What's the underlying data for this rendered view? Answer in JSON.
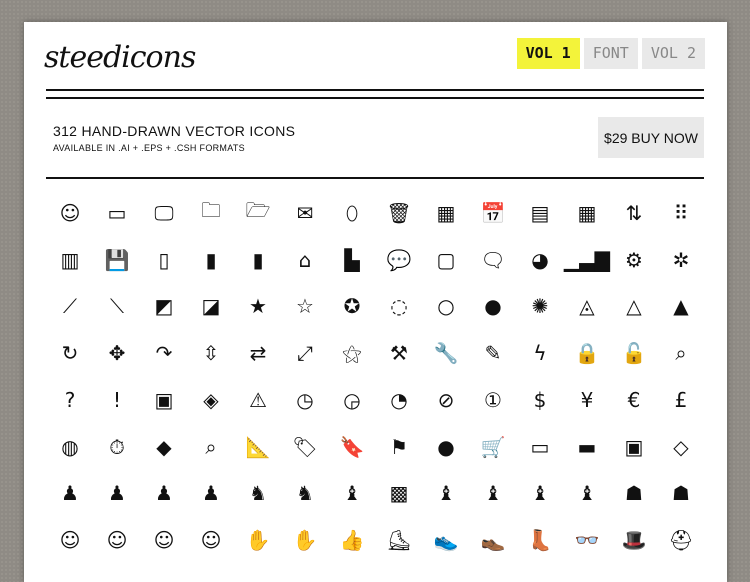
{
  "header": {
    "logo": "steedicons",
    "tabs": [
      {
        "label": "VOL 1",
        "active": true
      },
      {
        "label": "FONT",
        "active": false
      },
      {
        "label": "VOL 2",
        "active": false
      }
    ]
  },
  "intro": {
    "title": "312 HAND-DRAWN VECTOR ICONS",
    "formats": "AVAILABLE IN .AI + .EPS + .CSH FORMATS",
    "buy_label": "$29 BUY NOW"
  },
  "colors": {
    "accent": "#f3f33a",
    "tab_bg": "#e9e9e9",
    "ink": "#111111",
    "backdrop": "#8f8b85"
  },
  "icons": [
    [
      {
        "name": "finder-icon",
        "glyph": "☺"
      },
      {
        "name": "window-icon",
        "glyph": "▭"
      },
      {
        "name": "monitor-icon",
        "glyph": "🖵"
      },
      {
        "name": "folder-icon",
        "glyph": "🗀"
      },
      {
        "name": "open-folder-icon",
        "glyph": "🗁"
      },
      {
        "name": "mail-icon",
        "glyph": "✉"
      },
      {
        "name": "mouse-icon",
        "glyph": "⬯"
      },
      {
        "name": "trash-icon",
        "glyph": "🗑"
      },
      {
        "name": "calculator-icon",
        "glyph": "▦"
      },
      {
        "name": "calendar-11-icon",
        "glyph": "📅"
      },
      {
        "name": "calendar-icon",
        "glyph": "▤"
      },
      {
        "name": "table-icon",
        "glyph": "▦"
      },
      {
        "name": "sort-icon",
        "glyph": "⇅"
      },
      {
        "name": "grid-dots-icon",
        "glyph": "⠿"
      }
    ],
    [
      {
        "name": "ledger-icon",
        "glyph": "▥"
      },
      {
        "name": "floppy-disk-icon",
        "glyph": "💾"
      },
      {
        "name": "battery-low-icon",
        "glyph": "▯"
      },
      {
        "name": "battery-half-icon",
        "glyph": "▮"
      },
      {
        "name": "battery-full-icon",
        "glyph": "▮"
      },
      {
        "name": "home-icon",
        "glyph": "⌂"
      },
      {
        "name": "factory-icon",
        "glyph": "▙"
      },
      {
        "name": "chat-bubbles-icon",
        "glyph": "💬"
      },
      {
        "name": "speech-bubble-icon",
        "glyph": "▢"
      },
      {
        "name": "comment-icon",
        "glyph": "🗨"
      },
      {
        "name": "pie-chart-icon",
        "glyph": "◕"
      },
      {
        "name": "bar-chart-icon",
        "glyph": "▁▃▇"
      },
      {
        "name": "gear-icon",
        "glyph": "⚙"
      },
      {
        "name": "cog-outline-icon",
        "glyph": "✲"
      }
    ],
    [
      {
        "name": "trend-up-icon",
        "glyph": "⟋"
      },
      {
        "name": "trend-down-icon",
        "glyph": "⟍"
      },
      {
        "name": "chart-up-icon",
        "glyph": "◩"
      },
      {
        "name": "chart-down-icon",
        "glyph": "◪"
      },
      {
        "name": "star-filled-icon",
        "glyph": "★"
      },
      {
        "name": "star-outline-icon",
        "glyph": "☆"
      },
      {
        "name": "star-badge-icon",
        "glyph": "✪"
      },
      {
        "name": "circle-dashed-icon",
        "glyph": "◌"
      },
      {
        "name": "circle-outline-icon",
        "glyph": "○"
      },
      {
        "name": "circle-filled-icon",
        "glyph": "●"
      },
      {
        "name": "burst-icon",
        "glyph": "✺"
      },
      {
        "name": "triangle-dashed-icon",
        "glyph": "◬"
      },
      {
        "name": "triangle-outline-icon",
        "glyph": "△"
      },
      {
        "name": "triangle-filled-icon",
        "glyph": "▲"
      }
    ],
    [
      {
        "name": "refresh-icon",
        "glyph": "↻"
      },
      {
        "name": "move-icon",
        "glyph": "✥"
      },
      {
        "name": "share-arrow-icon",
        "glyph": "↷"
      },
      {
        "name": "up-down-arrows-icon",
        "glyph": "⇳"
      },
      {
        "name": "retweet-icon",
        "glyph": "⇄"
      },
      {
        "name": "expand-icon",
        "glyph": "⤢"
      },
      {
        "name": "magic-wand-icon",
        "glyph": "⚝"
      },
      {
        "name": "hammer-icon",
        "glyph": "⚒"
      },
      {
        "name": "wrench-icon",
        "glyph": "🔧"
      },
      {
        "name": "pencil-icon",
        "glyph": "✎"
      },
      {
        "name": "lightning-icon",
        "glyph": "ϟ"
      },
      {
        "name": "lock-icon",
        "glyph": "🔒"
      },
      {
        "name": "unlock-icon",
        "glyph": "🔓"
      },
      {
        "name": "search-icon",
        "glyph": "⌕"
      }
    ],
    [
      {
        "name": "question-icon",
        "glyph": "?"
      },
      {
        "name": "exclamation-icon",
        "glyph": "!"
      },
      {
        "name": "terminal-icon",
        "glyph": "▣"
      },
      {
        "name": "code-icon",
        "glyph": "◈"
      },
      {
        "name": "warning-icon",
        "glyph": "⚠"
      },
      {
        "name": "clock-icon",
        "glyph": "◷"
      },
      {
        "name": "clock-filled-icon",
        "glyph": "◶"
      },
      {
        "name": "gauge-icon",
        "glyph": "◔"
      },
      {
        "name": "prohibited-icon",
        "glyph": "⊘"
      },
      {
        "name": "number-one-icon",
        "glyph": "①"
      },
      {
        "name": "dollar-icon",
        "glyph": "$"
      },
      {
        "name": "yen-icon",
        "glyph": "¥"
      },
      {
        "name": "euro-icon",
        "glyph": "€"
      },
      {
        "name": "pound-icon",
        "glyph": "£"
      }
    ],
    [
      {
        "name": "chrome-icon",
        "glyph": "◍"
      },
      {
        "name": "stopwatch-icon",
        "glyph": "⏱"
      },
      {
        "name": "road-sign-icon",
        "glyph": "◆"
      },
      {
        "name": "find-window-icon",
        "glyph": "⌕"
      },
      {
        "name": "ruler-icon",
        "glyph": "📐"
      },
      {
        "name": "tag-icon",
        "glyph": "🏷"
      },
      {
        "name": "bookmark-icon",
        "glyph": "🔖"
      },
      {
        "name": "windows-icon",
        "glyph": "⚑"
      },
      {
        "name": "apple-icon",
        "glyph": "●"
      },
      {
        "name": "shopping-cart-icon",
        "glyph": "🛒"
      },
      {
        "name": "credit-card-icon",
        "glyph": "▭"
      },
      {
        "name": "banknote-icon",
        "glyph": "▬"
      },
      {
        "name": "cash-icon",
        "glyph": "▣"
      },
      {
        "name": "diamond-icon",
        "glyph": "◇"
      }
    ],
    [
      {
        "name": "user-silhouette-1-icon",
        "glyph": "♟"
      },
      {
        "name": "user-silhouette-2-icon",
        "glyph": "♟"
      },
      {
        "name": "user-silhouette-3-icon",
        "glyph": "♟"
      },
      {
        "name": "user-silhouette-4-icon",
        "glyph": "♟"
      },
      {
        "name": "user-hat-icon",
        "glyph": "♞"
      },
      {
        "name": "user-cap-icon",
        "glyph": "♞"
      },
      {
        "name": "user-suit-icon",
        "glyph": "♝"
      },
      {
        "name": "user-robot-icon",
        "glyph": "▩"
      },
      {
        "name": "user-add-icon",
        "glyph": "♝"
      },
      {
        "name": "user-icon",
        "glyph": "♝"
      },
      {
        "name": "user-medic-icon",
        "glyph": "♝"
      },
      {
        "name": "user-plain-icon",
        "glyph": "♝"
      },
      {
        "name": "group-icon",
        "glyph": "☗"
      },
      {
        "name": "group-add-icon",
        "glyph": "☗"
      }
    ],
    [
      {
        "name": "face-woman-icon",
        "glyph": "☺"
      },
      {
        "name": "face-man-icon",
        "glyph": "☺"
      },
      {
        "name": "face-hair-icon",
        "glyph": "☺"
      },
      {
        "name": "face-bald-icon",
        "glyph": "☺"
      },
      {
        "name": "hand-raised-icon",
        "glyph": "✋"
      },
      {
        "name": "hand-outline-icon",
        "glyph": "✋"
      },
      {
        "name": "thumbs-up-icon",
        "glyph": "👍"
      },
      {
        "name": "roller-skate-icon",
        "glyph": "⛸"
      },
      {
        "name": "sneaker-icon",
        "glyph": "👟"
      },
      {
        "name": "shoe-icon",
        "glyph": "👞"
      },
      {
        "name": "boot-icon",
        "glyph": "👢"
      },
      {
        "name": "glasses-icon",
        "glyph": "👓"
      },
      {
        "name": "hat-icon",
        "glyph": "🎩"
      },
      {
        "name": "helmet-icon",
        "glyph": "⛑"
      }
    ]
  ]
}
